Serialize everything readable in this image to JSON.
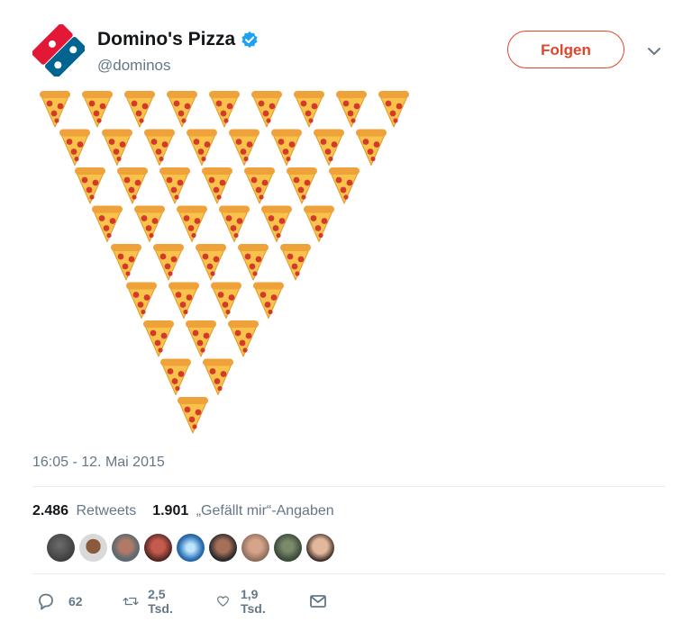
{
  "tweet": {
    "display_name": "Domino's Pizza",
    "handle": "@dominos",
    "follow_label": "Folgen",
    "timestamp": "16:05 - 12. Mai 2015"
  },
  "stats": {
    "retweets_count": "2.486",
    "retweets_label": "Retweets",
    "likes_count": "1.901",
    "likes_label": "„Gefällt mir“-Angaben"
  },
  "actions": {
    "reply_count": "62",
    "retweet_count": "2,5 Tsd.",
    "like_count": "1,9 Tsd."
  },
  "content": {
    "pizza_rows": [
      9,
      8,
      7,
      6,
      5,
      4,
      3,
      2,
      1
    ],
    "icon": "pizza-slice-emoji"
  },
  "colors": {
    "brand_red": "#e31837",
    "brand_blue": "#006491",
    "follow_accent": "#e0452a",
    "verified_blue": "#1da1f2"
  },
  "avatars": [
    "avatar-1",
    "avatar-2",
    "avatar-3",
    "avatar-4",
    "avatar-5",
    "avatar-6",
    "avatar-7",
    "avatar-8",
    "avatar-9"
  ]
}
